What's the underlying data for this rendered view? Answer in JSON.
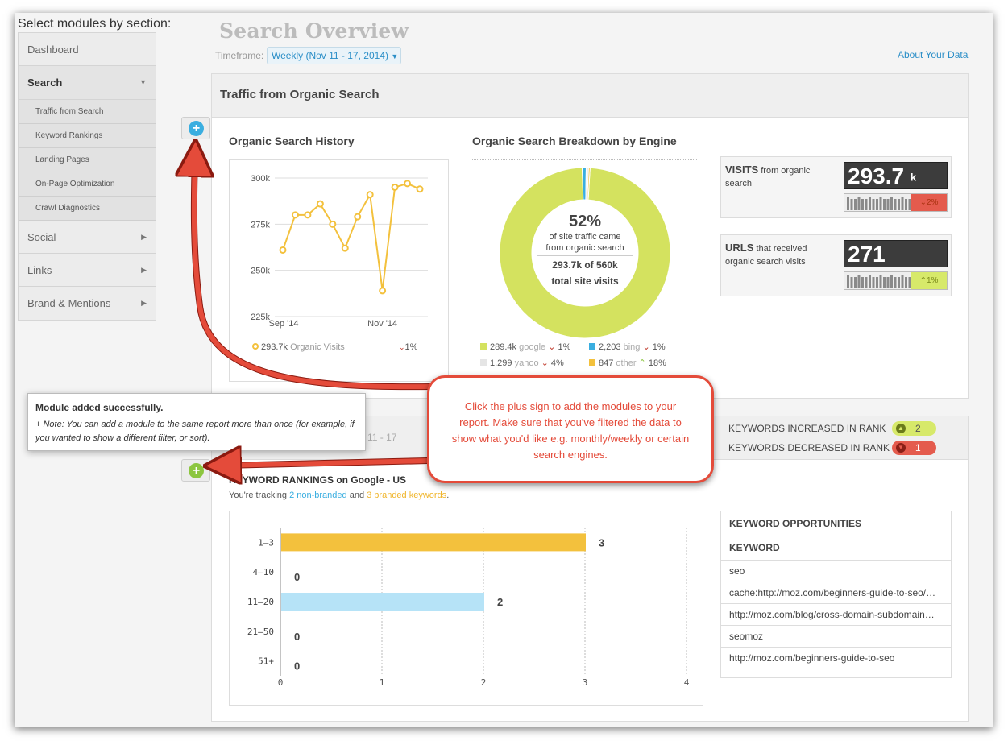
{
  "sidebar": {
    "title": "Select modules by section:",
    "items": [
      {
        "label": "Dashboard"
      },
      {
        "label": "Search"
      },
      {
        "label": "Social"
      },
      {
        "label": "Links"
      },
      {
        "label": "Brand & Mentions"
      }
    ],
    "search_subitems": [
      "Traffic from Search",
      "Keyword Rankings",
      "Landing Pages",
      "On-Page Optimization",
      "Crawl Diagnostics"
    ]
  },
  "header": {
    "title": "Search Overview",
    "timeframe_label": "Timeframe:",
    "timeframe_value": "Weekly (Nov 11 - 17, 2014)",
    "about_link": "About Your Data"
  },
  "traffic_panel": {
    "title": "Traffic from Organic Search",
    "history_title": "Organic Search History",
    "breakdown_title": "Organic Search Breakdown by Engine",
    "history_legend": "293.7k",
    "history_legend_label": "Organic Visits",
    "history_change": "1%",
    "donut": {
      "percent": "52%",
      "line1": "of site traffic came",
      "line2": "from organic search",
      "line3": "293.7k of 560k",
      "line4": "total site visits"
    },
    "engines": [
      {
        "value": "289.4k",
        "name": "google",
        "change": "1%",
        "color": "#d4e25f",
        "dir": "down"
      },
      {
        "value": "2,203",
        "name": "bing",
        "change": "1%",
        "color": "#3aaee0",
        "dir": "down"
      },
      {
        "value": "1,299",
        "name": "yahoo",
        "change": "4%",
        "color": "#e5e5e5",
        "dir": "down"
      },
      {
        "value": "847",
        "name": "other",
        "change": "18%",
        "color": "#f3c13d",
        "dir": "up"
      }
    ],
    "visits": {
      "label_bold": "VISITS",
      "label_rest": "from organic search",
      "value": "293.7",
      "unit": "k",
      "change": "2%"
    },
    "urls": {
      "label_bold": "URLS",
      "label_rest": "that received organic search visits",
      "value": "271",
      "change": "1%"
    }
  },
  "chart_data": [
    {
      "type": "line",
      "series": [
        {
          "name": "Organic Visits",
          "values": [
            261,
            280,
            280,
            286,
            275,
            262,
            279,
            291,
            239,
            295,
            297,
            294
          ]
        }
      ],
      "x_ticks": [
        "Sep '14",
        "Nov '14"
      ],
      "y_ticks": [
        "300k",
        "275k",
        "250k",
        "225k"
      ],
      "ylim": [
        225,
        300
      ],
      "color": "#f3c13d"
    },
    {
      "type": "pie",
      "categories": [
        "google",
        "bing",
        "yahoo",
        "other"
      ],
      "values": [
        289.4,
        2.203,
        1.299,
        0.847
      ],
      "colors": [
        "#d4e25f",
        "#3aaee0",
        "#e5e5e5",
        "#f3c13d"
      ]
    },
    {
      "type": "bar",
      "categories": [
        "1–3",
        "4–10",
        "11–20",
        "21–50",
        "51+"
      ],
      "values": [
        3,
        0,
        2,
        0,
        0
      ],
      "colors": [
        "#f3c13d",
        "#f3c13d",
        "#b6e3f7",
        "#b6e3f7",
        "#b6e3f7"
      ],
      "xlim": [
        0,
        4
      ],
      "x_ticks": [
        "0",
        "1",
        "2",
        "3",
        "4"
      ]
    }
  ],
  "tooltip": {
    "title": "Module added successfully.",
    "note": "+ Note: You can add a module to the same report more than once (for example, if you wanted to show a different filter, or sort)."
  },
  "callout": {
    "text": "Click the plus sign to add the modules to your report. Make sure that you've filtered the data to show what you'd like e.g. monthly/weekly or certain search engines."
  },
  "keywords_panel": {
    "partial_header": "11 - 17",
    "increased_label": "KEYWORDS INCREASED IN RANK",
    "increased_value": "2",
    "decreased_label": "KEYWORDS DECREASED IN RANK",
    "decreased_value": "1",
    "rankings_title": "KEYWORD RANKINGS on Google - US",
    "tracking_prefix": "You're tracking",
    "non_branded": "2 non-branded",
    "tracking_and": "and",
    "branded": "3 branded keywords",
    "tracking_suffix": ".",
    "opportunities_title": "KEYWORD OPPORTUNITIES",
    "keyword_col": "KEYWORD",
    "keywords": [
      "seo",
      "cache:http://moz.com/beginners-guide-to-seo/…",
      "http://moz.com/blog/cross-domain-subdomain…",
      "seomoz",
      "http://moz.com/beginners-guide-to-seo"
    ]
  },
  "colors": {
    "accent_blue": "#2a8ec7",
    "callout_red": "#e44b3a",
    "plus_blue": "#3aaee0",
    "plus_green": "#8cc63f"
  }
}
